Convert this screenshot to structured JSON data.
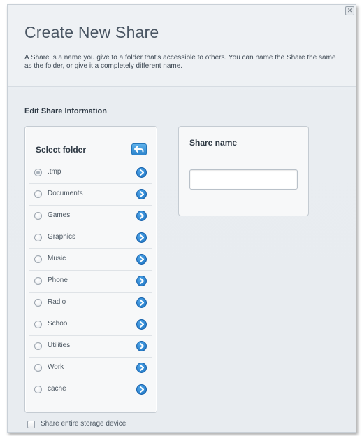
{
  "dialog": {
    "title": "Create New Share",
    "description": "A Share is a name you give to a folder that's accessible to others. You can name the Share the same as the folder, or give it a completely different name.",
    "close_icon": "close-icon"
  },
  "section": {
    "title": "Edit Share Information"
  },
  "folder_panel": {
    "title": "Select folder",
    "back_icon": "back-arrow-icon",
    "folders": [
      {
        "name": ".tmp",
        "checked": true
      },
      {
        "name": "Documents",
        "checked": false
      },
      {
        "name": "Games",
        "checked": false
      },
      {
        "name": "Graphics",
        "checked": false
      },
      {
        "name": "Music",
        "checked": false
      },
      {
        "name": "Phone",
        "checked": false
      },
      {
        "name": "Radio",
        "checked": false
      },
      {
        "name": "School",
        "checked": false
      },
      {
        "name": "Utilities",
        "checked": false
      },
      {
        "name": "Work",
        "checked": false
      },
      {
        "name": "cache",
        "checked": false
      }
    ]
  },
  "share_panel": {
    "label": "Share name",
    "input_value": "",
    "input_placeholder": ""
  },
  "options": {
    "entire_device_label": "Share entire storage device",
    "entire_device_checked": false
  },
  "colors": {
    "accent_blue": "#2c83cc",
    "title_text": "#4a5663",
    "background": "#eef1f4"
  }
}
